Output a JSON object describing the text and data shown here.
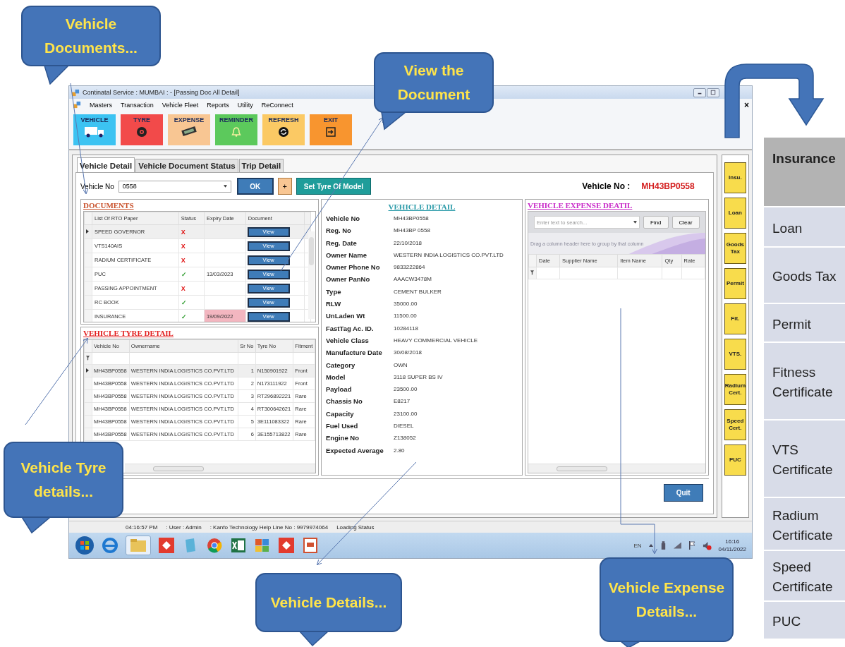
{
  "callouts": [
    {
      "text": "Vehicle Documents...",
      "kind": "documents"
    },
    {
      "text": "View the Document",
      "kind": "view"
    },
    {
      "text": "Vehicle Tyre details...",
      "kind": "tyre"
    },
    {
      "text": "Vehicle Details...",
      "kind": "details"
    },
    {
      "text": "Vehicle Expense Details...",
      "kind": "expense"
    }
  ],
  "window": {
    "title": "Continatal Service : MUMBAI :  - [Passing Doc All Detail]",
    "mdi_close": "×"
  },
  "menu": [
    "Masters",
    "Transaction",
    "Vehicle Fleet",
    "Reports",
    "Utility",
    "ReConnect"
  ],
  "toolbar": [
    {
      "label": "VEHICLE",
      "kind": "truck",
      "color": "#3cc3f2"
    },
    {
      "label": "TYRE",
      "kind": "tyre",
      "color": "#f24a4a"
    },
    {
      "label": "EXPENSE",
      "kind": "money",
      "color": "#f8c693"
    },
    {
      "label": "REMINDER",
      "kind": "bell",
      "color": "#5cc95c"
    },
    {
      "label": "REFRESH",
      "kind": "refresh",
      "color": "#fbc964"
    },
    {
      "label": "EXIT",
      "kind": "exit",
      "color": "#f8952f"
    }
  ],
  "tabs": [
    {
      "label": "Vehicle Detail",
      "selected": true
    },
    {
      "label": "Vehicle Document Status",
      "selected": false
    },
    {
      "label": "Trip Detail",
      "selected": false
    }
  ],
  "vehicle_select": {
    "label": "Vehicle No",
    "value": "0558"
  },
  "buttons": {
    "ok": "OK",
    "plus": "+",
    "set_tyre": "Set Tyre Of Model",
    "quit": "Quit"
  },
  "vehicle_no_display": {
    "label": "Vehicle No :",
    "value": "MH43BP0558"
  },
  "documents": {
    "title": "DOCUMENTS",
    "columns": [
      "List Of RTO Paper",
      "Status",
      "Expiry Date",
      "Document"
    ],
    "rows": [
      {
        "paper": "SPEED GOVERNOR",
        "status": "X",
        "ok": false,
        "expiry": "",
        "expired": false,
        "document": "View",
        "selected": true
      },
      {
        "paper": "VTS140AIS",
        "status": "X",
        "ok": false,
        "expiry": "",
        "expired": false,
        "document": "View",
        "selected": false
      },
      {
        "paper": "RADIUM CERTIFICATE",
        "status": "X",
        "ok": false,
        "expiry": "",
        "expired": false,
        "document": "View",
        "selected": false
      },
      {
        "paper": "PUC",
        "status": "✓",
        "ok": true,
        "expiry": "13/03/2023",
        "expired": false,
        "document": "View",
        "selected": false
      },
      {
        "paper": "PASSING APPOINTMENT",
        "status": "X",
        "ok": false,
        "expiry": "",
        "expired": false,
        "document": "View",
        "selected": false
      },
      {
        "paper": "RC BOOK",
        "status": "✓",
        "ok": true,
        "expiry": "",
        "expired": false,
        "document": "View",
        "selected": false
      },
      {
        "paper": "INSURANCE",
        "status": "✓",
        "ok": true,
        "expiry": "19/09/2022",
        "expired": true,
        "document": "View",
        "selected": false
      }
    ]
  },
  "tyres": {
    "title": "VEHICLE TYRE DETAIL",
    "columns": [
      "Vehicle No",
      "Ownername",
      "Sr No",
      "Tyre No",
      "Fitment"
    ],
    "rows": [
      {
        "vehicle": "MH43BP0558",
        "owner": "WESTERN INDIA LOGISTICS CO.PVT.LTD",
        "sr": "1",
        "tyre": "N150901922",
        "fitment": "Front",
        "selected": true
      },
      {
        "vehicle": "MH43BP0558",
        "owner": "WESTERN INDIA LOGISTICS CO.PVT.LTD",
        "sr": "2",
        "tyre": "N173111922",
        "fitment": "Front",
        "selected": false
      },
      {
        "vehicle": "MH43BP0558",
        "owner": "WESTERN INDIA LOGISTICS CO.PVT.LTD",
        "sr": "3",
        "tyre": "RT296892221",
        "fitment": "Rare",
        "selected": false
      },
      {
        "vehicle": "MH43BP0558",
        "owner": "WESTERN INDIA LOGISTICS CO.PVT.LTD",
        "sr": "4",
        "tyre": "RT300642621",
        "fitment": "Rare",
        "selected": false
      },
      {
        "vehicle": "MH43BP0558",
        "owner": "WESTERN INDIA LOGISTICS CO.PVT.LTD",
        "sr": "5",
        "tyre": "3E111083322",
        "fitment": "Rare",
        "selected": false
      },
      {
        "vehicle": "MH43BP0558",
        "owner": "WESTERN INDIA LOGISTICS CO.PVT.LTD",
        "sr": "6",
        "tyre": "3E155713822",
        "fitment": "Rare",
        "selected": false
      }
    ]
  },
  "vehicle_detail": {
    "title": "VEHICLE DETAIL",
    "fields": [
      {
        "label": "Vehicle No",
        "value": "MH43BP0558"
      },
      {
        "label": "Reg. No",
        "value": "MH43BP 0558"
      },
      {
        "label": "Reg. Date",
        "value": "22/10/2018"
      },
      {
        "label": "Owner Name",
        "value": "WESTERN INDIA LOGISTICS CO.PVT.LTD"
      },
      {
        "label": "Owner Phone No",
        "value": "9833222864"
      },
      {
        "label": "Owner PanNo",
        "value": "AAACW3478M"
      },
      {
        "label": "Type",
        "value": "CEMENT BULKER"
      },
      {
        "label": "RLW",
        "value": "35000.00"
      },
      {
        "label": "UnLaden Wt",
        "value": "11500.00"
      },
      {
        "label": "FastTag Ac. ID.",
        "value": "10284118"
      },
      {
        "label": "Vehicle Class",
        "value": "HEAVY COMMERCIAL VEHICLE"
      },
      {
        "label": "Manufacture Date",
        "value": "30/08/2018"
      },
      {
        "label": "Category",
        "value": "OWN"
      },
      {
        "label": "Model",
        "value": "3118 SUPER BS IV"
      },
      {
        "label": "Payload",
        "value": "23500.00"
      },
      {
        "label": "Chassis No",
        "value": "E8217"
      },
      {
        "label": "Capacity",
        "value": "23100.00"
      },
      {
        "label": "Fuel Used",
        "value": "DIESEL"
      },
      {
        "label": "Engine No",
        "value": "Z138052"
      },
      {
        "label": "Expected Average",
        "value": "2.80"
      }
    ]
  },
  "expense": {
    "title": "VEHICLE EXPENSE DEATIL",
    "search_placeholder": "Enter text to search...",
    "find": "Find",
    "clear": "Clear",
    "group_hint": "Drag a column header here to group by that column",
    "columns": [
      "Date",
      "Supplier Name",
      "Item Name",
      "Qty",
      "Rate"
    ]
  },
  "side_buttons": [
    "Insu.",
    "Loan",
    "Goods Tax",
    "Permit",
    "Fit.",
    "VTS.",
    "Radium Cert.",
    "Speed Cert.",
    "PUC"
  ],
  "status_bar": [
    "04:16:57 PM",
    ": User : Admin",
    ": Kanfo Technology Help Line No : 9979974064",
    "Loading Status"
  ],
  "taskbar": {
    "language": "EN",
    "time": "16:16",
    "date": "04/11/2022"
  },
  "reminder_list": [
    {
      "label": "Insurance",
      "selected": true
    },
    {
      "label": "Loan",
      "selected": false
    },
    {
      "label": "Goods Tax",
      "selected": false
    },
    {
      "label": "Permit",
      "selected": false
    },
    {
      "label": "Fitness Certificate",
      "selected": false
    },
    {
      "label": "VTS Certificate",
      "selected": false
    },
    {
      "label": "Radium Certificate",
      "selected": false
    },
    {
      "label": "Speed Certificate",
      "selected": false
    },
    {
      "label": "PUC",
      "selected": false
    }
  ]
}
